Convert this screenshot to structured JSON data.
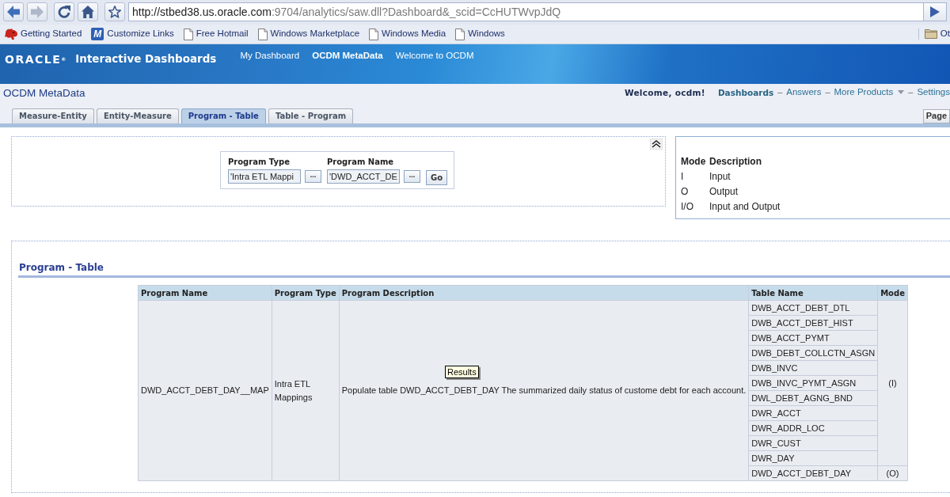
{
  "browser": {
    "nav_buttons": [
      {
        "kind": "back",
        "disabled": false
      },
      {
        "kind": "forward",
        "disabled": true
      },
      {
        "kind": "reload",
        "disabled": false
      },
      {
        "kind": "home",
        "disabled": false
      },
      {
        "kind": "bookmark",
        "disabled": false
      }
    ],
    "address": {
      "host": "http://stbed38.us.oracle.com",
      "path": ":9704/analytics/saw.dll?Dashboard&_scid=CcHUTWvpJdQ"
    },
    "bookmarks": [
      {
        "label": "Getting Started",
        "kind": "animal"
      },
      {
        "label": "Customize Links",
        "kind": "letter",
        "icon_text": "M"
      },
      {
        "label": "Free Hotmail",
        "kind": "page"
      },
      {
        "label": "Windows Marketplace",
        "kind": "page"
      },
      {
        "label": "Windows Media",
        "kind": "page"
      },
      {
        "label": "Windows",
        "kind": "page"
      }
    ],
    "other_bookmarks": "Ot"
  },
  "header": {
    "logo": "ORACLE",
    "logo_mark": "®",
    "product": "Interactive Dashboards",
    "nav": [
      {
        "label": "My Dashboard",
        "selected": false
      },
      {
        "label": "OCDM MetaData",
        "selected": true
      },
      {
        "label": "Welcome to OCDM",
        "selected": false
      }
    ]
  },
  "subheader": {
    "title": "OCDM MetaData",
    "welcome": "Welcome, ocdm!",
    "links": [
      {
        "label": "Dashboards",
        "selected": true
      },
      {
        "separator": "–",
        "label": "Answers",
        "selected": false
      },
      {
        "separator": "–",
        "label": "More Products",
        "selected": false,
        "dropdown": true
      },
      {
        "separator": "–",
        "label": "Settings",
        "selected": false
      }
    ]
  },
  "tabs": [
    {
      "label": "Measure-Entity",
      "selected": false
    },
    {
      "label": "Entity-Measure",
      "selected": false
    },
    {
      "label": "Program - Table",
      "selected": true
    },
    {
      "label": "Table - Program",
      "selected": false
    }
  ],
  "page_button": "Page",
  "prompts": {
    "fields": [
      {
        "label": "Program Type",
        "value": "'Intra ETL Mappi",
        "browse_label": "..."
      },
      {
        "label": "Program Name",
        "value": "'DWD_ACCT_DE",
        "browse_label": "..."
      }
    ],
    "go_label": "Go"
  },
  "mode_legend": {
    "headers": [
      "Mode",
      "Description"
    ],
    "rows": [
      {
        "mode": "I",
        "description": "Input"
      },
      {
        "mode": "O",
        "description": "Output"
      },
      {
        "mode": "I/O",
        "description": "Input and Output"
      }
    ]
  },
  "results": {
    "title": "Program - Table",
    "columns": [
      "Program Name",
      "Program Type",
      "Program Description",
      "Table Name",
      "Mode"
    ],
    "program_name": "DWD_ACCT_DEBT_DAY__MAP",
    "program_type": "Intra ETL Mappings",
    "description": "Populate table DWD_ACCT_DEBT_DAY The summarized daily status of custome debt for each account.",
    "mode_groups": [
      {
        "mode": "(I)",
        "tables": [
          "DWB_ACCT_DEBT_DTL",
          "DWB_ACCT_DEBT_HIST",
          "DWB_ACCT_PYMT",
          "DWB_DEBT_COLLCTN_ASGN",
          "DWB_INVC",
          "DWB_INVC_PYMT_ASGN",
          "DWL_DEBT_AGNG_BND",
          "DWR_ACCT",
          "DWR_ADDR_LOC",
          "DWR_CUST",
          "DWR_DAY"
        ]
      },
      {
        "mode": "(O)",
        "tables": [
          "DWD_ACCT_DEBT_DAY"
        ]
      }
    ],
    "tooltip": "Results"
  }
}
